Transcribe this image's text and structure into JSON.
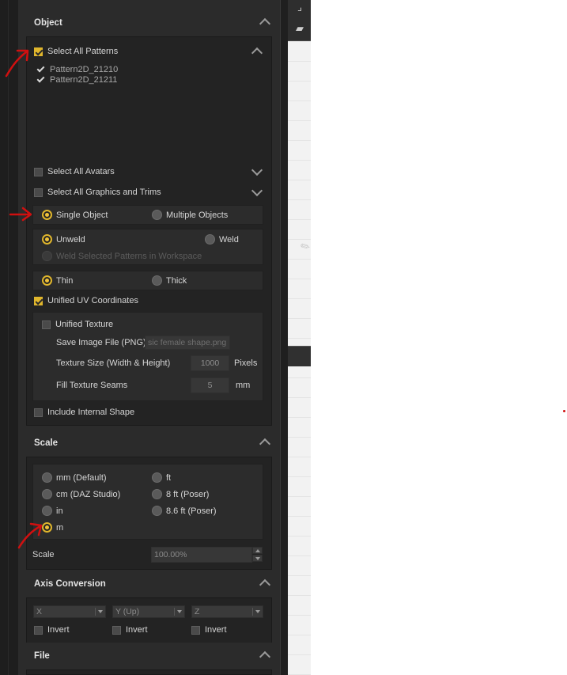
{
  "object": {
    "title": "Object",
    "patterns": {
      "select_all_label": "Select All Patterns",
      "items": [
        {
          "name": "Pattern2D_21210",
          "checked": true
        },
        {
          "name": "Pattern2D_21211",
          "checked": true
        }
      ]
    },
    "select_all_avatars": "Select All Avatars",
    "select_all_graphics": "Select All Graphics and Trims",
    "single_object": "Single Object",
    "multiple_objects": "Multiple Objects",
    "unweld": "Unweld",
    "weld": "Weld",
    "weld_selected": "Weld Selected Patterns in Workspace",
    "thin": "Thin",
    "thick": "Thick",
    "unified_uv": "Unified UV Coordinates",
    "unified_texture": "Unified Texture",
    "save_image_label": "Save Image File (PNG)",
    "save_image_value": "sic female shape.png",
    "texture_size_label": "Texture Size (Width & Height)",
    "texture_size_value": "1000",
    "texture_size_unit": "Pixels",
    "fill_seams_label": "Fill Texture Seams",
    "fill_seams_value": "5",
    "fill_seams_unit": "mm",
    "include_internal": "Include Internal Shape"
  },
  "scale": {
    "title": "Scale",
    "options": {
      "mm": "mm (Default)",
      "cm": "cm (DAZ Studio)",
      "in": "in",
      "m": "m",
      "ft": "ft",
      "ft8": "8 ft (Poser)",
      "ft86": "8.6 ft (Poser)"
    },
    "selected": "m",
    "scale_label": "Scale",
    "scale_value": "100.00%"
  },
  "axis": {
    "title": "Axis Conversion",
    "x": "X",
    "y": "Y (Up)",
    "z": "Z",
    "invert": "Invert"
  },
  "file": {
    "title": "File"
  },
  "colors": {
    "panel_bg": "#2b2b2b",
    "accent": "#e0b62c",
    "annotation_red": "#d01010"
  }
}
